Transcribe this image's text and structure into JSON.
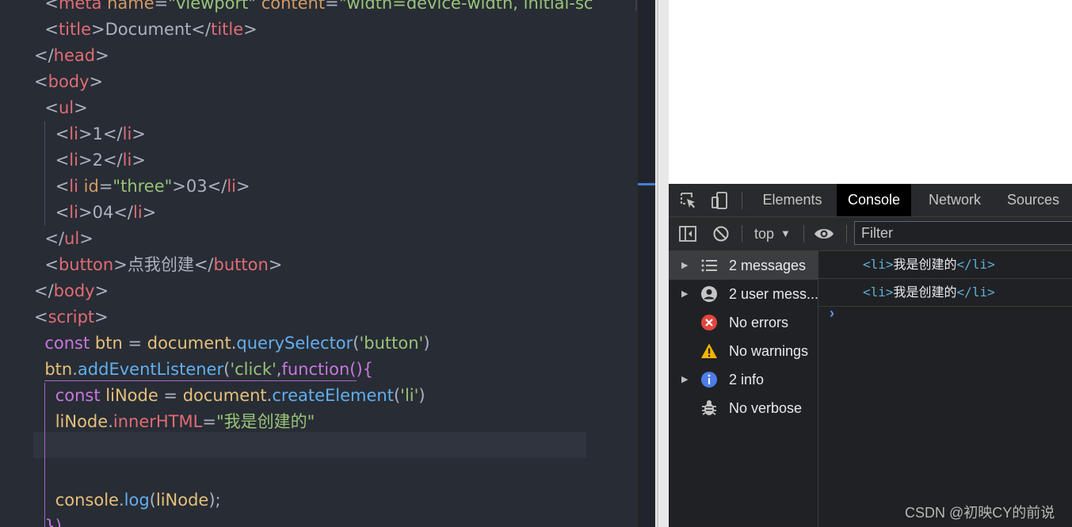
{
  "editor": {
    "lines": [
      [
        {
          "t": "  <",
          "c": "p"
        },
        {
          "t": "meta",
          "c": "tag"
        },
        {
          "t": " name",
          "c": "attr"
        },
        {
          "t": "=",
          "c": "p"
        },
        {
          "t": "\"viewport\"",
          "c": "str"
        },
        {
          "t": " content",
          "c": "attr"
        },
        {
          "t": "=",
          "c": "p"
        },
        {
          "t": "\"width=device-width, initial-sc",
          "c": "str"
        }
      ],
      [
        {
          "t": "  <",
          "c": "p"
        },
        {
          "t": "title",
          "c": "tag"
        },
        {
          "t": ">",
          "c": "p"
        },
        {
          "t": "Document",
          "c": "txt"
        },
        {
          "t": "</",
          "c": "p"
        },
        {
          "t": "title",
          "c": "tag"
        },
        {
          "t": ">",
          "c": "p"
        }
      ],
      [
        {
          "t": "</",
          "c": "p"
        },
        {
          "t": "head",
          "c": "tag"
        },
        {
          "t": ">",
          "c": "p"
        }
      ],
      [
        {
          "t": "<",
          "c": "p"
        },
        {
          "t": "body",
          "c": "tag"
        },
        {
          "t": ">",
          "c": "p"
        }
      ],
      [
        {
          "t": "  <",
          "c": "p"
        },
        {
          "t": "ul",
          "c": "tag"
        },
        {
          "t": ">",
          "c": "p"
        }
      ],
      [
        {
          "t": "    <",
          "c": "p"
        },
        {
          "t": "li",
          "c": "tag"
        },
        {
          "t": ">",
          "c": "p"
        },
        {
          "t": "1",
          "c": "txt"
        },
        {
          "t": "</",
          "c": "p"
        },
        {
          "t": "li",
          "c": "tag"
        },
        {
          "t": ">",
          "c": "p"
        }
      ],
      [
        {
          "t": "    <",
          "c": "p"
        },
        {
          "t": "li",
          "c": "tag"
        },
        {
          "t": ">",
          "c": "p"
        },
        {
          "t": "2",
          "c": "txt"
        },
        {
          "t": "</",
          "c": "p"
        },
        {
          "t": "li",
          "c": "tag"
        },
        {
          "t": ">",
          "c": "p"
        }
      ],
      [
        {
          "t": "    <",
          "c": "p"
        },
        {
          "t": "li",
          "c": "tag"
        },
        {
          "t": " id",
          "c": "attr"
        },
        {
          "t": "=",
          "c": "p"
        },
        {
          "t": "\"three\"",
          "c": "str"
        },
        {
          "t": ">",
          "c": "p"
        },
        {
          "t": "03",
          "c": "txt"
        },
        {
          "t": "</",
          "c": "p"
        },
        {
          "t": "li",
          "c": "tag"
        },
        {
          "t": ">",
          "c": "p"
        }
      ],
      [
        {
          "t": "    <",
          "c": "p"
        },
        {
          "t": "li",
          "c": "tag"
        },
        {
          "t": ">",
          "c": "p"
        },
        {
          "t": "04",
          "c": "txt"
        },
        {
          "t": "</",
          "c": "p"
        },
        {
          "t": "li",
          "c": "tag"
        },
        {
          "t": ">",
          "c": "p"
        }
      ],
      [
        {
          "t": "  </",
          "c": "p"
        },
        {
          "t": "ul",
          "c": "tag"
        },
        {
          "t": ">",
          "c": "p"
        }
      ],
      [
        {
          "t": "  <",
          "c": "p"
        },
        {
          "t": "button",
          "c": "tag"
        },
        {
          "t": ">",
          "c": "p"
        },
        {
          "t": "点我创建",
          "c": "txt"
        },
        {
          "t": "</",
          "c": "p"
        },
        {
          "t": "button",
          "c": "tag"
        },
        {
          "t": ">",
          "c": "p"
        }
      ],
      [
        {
          "t": "</",
          "c": "p"
        },
        {
          "t": "body",
          "c": "tag"
        },
        {
          "t": ">",
          "c": "p"
        }
      ],
      [
        {
          "t": "<",
          "c": "p"
        },
        {
          "t": "script",
          "c": "tag"
        },
        {
          "t": ">",
          "c": "p"
        }
      ],
      [
        {
          "t": "  const",
          "c": "kw"
        },
        {
          "t": " btn",
          "c": "var"
        },
        {
          "t": " = ",
          "c": "p"
        },
        {
          "t": "document",
          "c": "var"
        },
        {
          "t": ".",
          "c": "p"
        },
        {
          "t": "querySelector",
          "c": "fn"
        },
        {
          "t": "(",
          "c": "p"
        },
        {
          "t": "'button'",
          "c": "str"
        },
        {
          "t": ")",
          "c": "p"
        }
      ],
      [
        {
          "t": "  btn",
          "c": "var"
        },
        {
          "t": ".",
          "c": "p"
        },
        {
          "t": "addEventListener",
          "c": "fn"
        },
        {
          "t": "(",
          "c": "p"
        },
        {
          "t": "'click'",
          "c": "str"
        },
        {
          "t": ",",
          "c": "p"
        },
        {
          "t": "function",
          "c": "kw"
        },
        {
          "t": "(){",
          "c": "kw"
        }
      ],
      [
        {
          "t": "    const",
          "c": "kw"
        },
        {
          "t": " liNode",
          "c": "var"
        },
        {
          "t": " = ",
          "c": "p"
        },
        {
          "t": "document",
          "c": "var"
        },
        {
          "t": ".",
          "c": "p"
        },
        {
          "t": "createElement",
          "c": "fn"
        },
        {
          "t": "(",
          "c": "p"
        },
        {
          "t": "'li'",
          "c": "str"
        },
        {
          "t": ")",
          "c": "p"
        }
      ],
      [
        {
          "t": "    liNode",
          "c": "var"
        },
        {
          "t": ".",
          "c": "p"
        },
        {
          "t": "innerHTML",
          "c": "tag"
        },
        {
          "t": "=",
          "c": "p"
        },
        {
          "t": "\"我是创建的\"",
          "c": "str"
        }
      ],
      [],
      [],
      [
        {
          "t": "    console",
          "c": "var"
        },
        {
          "t": ".",
          "c": "p"
        },
        {
          "t": "log",
          "c": "fn"
        },
        {
          "t": "(",
          "c": "p"
        },
        {
          "t": "liNode",
          "c": "var"
        },
        {
          "t": ");",
          "c": "p"
        }
      ],
      [
        {
          "t": "  })",
          "c": "kw"
        }
      ]
    ]
  },
  "devtools": {
    "tabs": {
      "elements": "Elements",
      "console": "Console",
      "network": "Network",
      "sources": "Sources"
    },
    "toolbar": {
      "context": "top",
      "filter_placeholder": "Filter"
    },
    "sidebar": {
      "messages": "2 messages",
      "user_messages": "2 user mess...",
      "errors": "No errors",
      "warnings": "No warnings",
      "info": "2 info",
      "verbose": "No verbose"
    },
    "console": {
      "entries": [
        {
          "open_tag": "<li>",
          "text": "我是创建的",
          "close_tag": "</li>"
        },
        {
          "open_tag": "<li>",
          "text": "我是创建的",
          "close_tag": "</li>"
        }
      ],
      "prompt": "›"
    }
  },
  "watermark": "CSDN @初映CY的前说",
  "colors": {
    "editor_bg": "#282c34",
    "devtools_bg": "#202124",
    "tag": "#e06c75",
    "string": "#98c379",
    "keyword": "#c678dd",
    "function": "#61afef",
    "variable": "#e5c07b",
    "console_tag": "#5db0d7"
  }
}
